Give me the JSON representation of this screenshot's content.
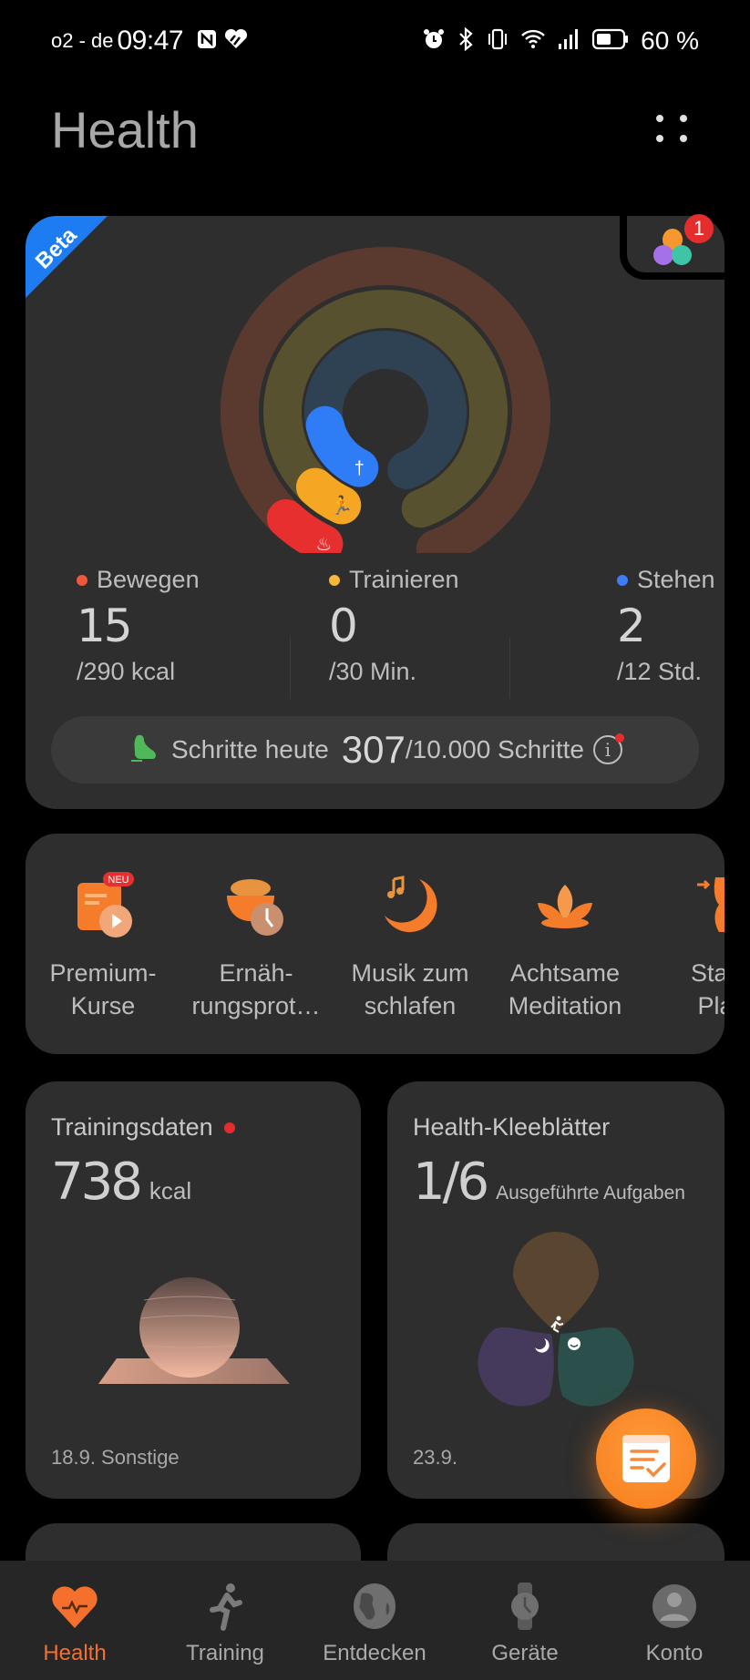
{
  "status_bar": {
    "carrier": "o2 - de",
    "time": "09:47",
    "battery_text": "60 %",
    "battery_level_percent": 60,
    "left_icons": [
      "nfc-icon",
      "health-app-icon"
    ],
    "right_icons": [
      "alarm-icon",
      "bluetooth-icon",
      "vibrate-icon",
      "wifi-icon",
      "signal-icon",
      "battery-icon"
    ]
  },
  "header": {
    "title": "Health",
    "menu_icon": "more-dots-icon"
  },
  "activity_card": {
    "beta_label": "Beta",
    "widget_badge_count": "1",
    "rings": [
      {
        "name": "Bewegen",
        "value": 15,
        "goal": 290,
        "color": "#e82f2f",
        "track_color": "#5a3a2f",
        "icon": "flame-icon"
      },
      {
        "name": "Trainieren",
        "value": 0,
        "goal": 30,
        "color": "#f5a623",
        "track_color": "#57512f",
        "icon": "running-icon"
      },
      {
        "name": "Stehen",
        "value": 2,
        "goal": 12,
        "color": "#2e7cf6",
        "track_color": "#2e4254",
        "icon": "standing-person-icon"
      }
    ],
    "stats": [
      {
        "label": "Bewegen",
        "value": "15",
        "goal": "/290 kcal",
        "dot_color": "#f0563a"
      },
      {
        "label": "Trainieren",
        "value": "0",
        "goal": "/30 Min.",
        "dot_color": "#f6b93b"
      },
      {
        "label": "Stehen",
        "value": "2",
        "goal": "/12 Std.",
        "dot_color": "#3f7df6"
      }
    ],
    "steps": {
      "label": "Schritte heute",
      "value": "307",
      "goal": "/10.000 Schritte",
      "icon_color": "#4fb85a"
    }
  },
  "shortcuts": [
    {
      "label": "Premium-\nKurse",
      "icon": "premium-courses-icon",
      "badge": "NEU"
    },
    {
      "label": "Ernäh-\nrungsprot…",
      "icon": "nutrition-log-icon"
    },
    {
      "label": "Musik zum\nschlafen",
      "icon": "sleep-music-icon"
    },
    {
      "label": "Achtsame\nMeditation",
      "icon": "meditation-lotus-icon"
    },
    {
      "label": "Stay\nPla",
      "icon": "stay-plan-icon"
    }
  ],
  "training_card": {
    "title": "Trainingsdaten",
    "value": "738",
    "unit": "kcal",
    "footer": "18.9. Sonstige"
  },
  "clover_card": {
    "title": "Health-Kleeblätter",
    "value": "1/6",
    "unit": "Ausgeführte Aufgaben",
    "footer": "23.9.",
    "leaves": [
      {
        "name": "exercise",
        "color": "#5a4530",
        "icon": "running-icon"
      },
      {
        "name": "sleep",
        "color": "#463a5c",
        "icon": "moon-sleep-icon"
      },
      {
        "name": "mood",
        "color": "#2b4f4a",
        "icon": "smile-icon"
      }
    ]
  },
  "accent_color": "#f5702d",
  "bottom_nav": [
    {
      "label": "Health",
      "icon": "heart-pulse-icon",
      "active": true
    },
    {
      "label": "Training",
      "icon": "running-icon",
      "active": false
    },
    {
      "label": "Entdecken",
      "icon": "globe-icon",
      "active": false
    },
    {
      "label": "Geräte",
      "icon": "watch-icon",
      "active": false
    },
    {
      "label": "Konto",
      "icon": "account-icon",
      "active": false
    }
  ]
}
